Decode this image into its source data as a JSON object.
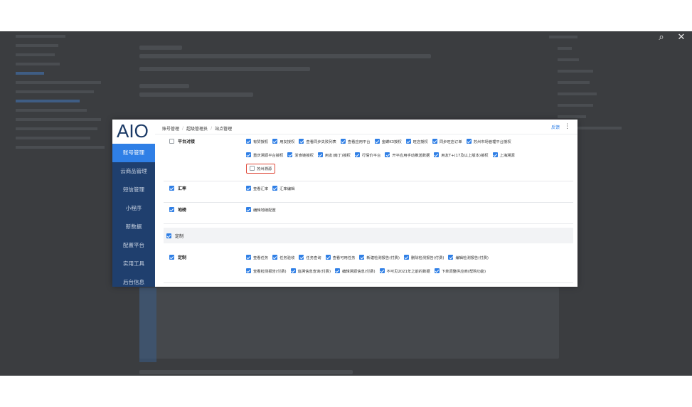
{
  "viewer": {
    "zoom_icon": "search-icon",
    "close_icon": "close-icon",
    "zoom_glyph": "⌕",
    "close_glyph": "✕"
  },
  "screenshot": {
    "brand": "AIO",
    "sidebar": [
      {
        "label": "账号管理",
        "active": true
      },
      {
        "label": "云商品管理",
        "active": false
      },
      {
        "label": "短信管理",
        "active": false
      },
      {
        "label": "小程序",
        "active": false
      },
      {
        "label": "新数据",
        "active": false
      },
      {
        "label": "配置平台",
        "active": false
      },
      {
        "label": "实用工具",
        "active": false
      },
      {
        "label": "后台信息",
        "active": false
      }
    ],
    "breadcrumb": [
      "账号管理",
      "超级管理员",
      "站点管理"
    ],
    "feedback": "反馈",
    "more_glyph": "⋮",
    "rows": [
      {
        "label": "平台对接",
        "checked": false,
        "lines": [
          [
            {
              "text": "有赞授权",
              "checked": true
            },
            {
              "text": "用友授权",
              "checked": true
            },
            {
              "text": "查看同步失败列表",
              "checked": true
            },
            {
              "text": "查看应用平台",
              "checked": true
            },
            {
              "text": "金蝶K3授权",
              "checked": true
            },
            {
              "text": "旺店授权",
              "checked": true
            },
            {
              "text": "同步旺店订单",
              "checked": true
            },
            {
              "text": "苏州市场管理平台授权",
              "checked": true
            }
          ],
          [
            {
              "text": "重庆溯源平台授权",
              "checked": true
            },
            {
              "text": "浙食链授权",
              "checked": true
            },
            {
              "text": "用友(南丁)授权",
              "checked": true
            },
            {
              "text": "行情价平台",
              "checked": true
            },
            {
              "text": "开平应用手动推送数据",
              "checked": true
            },
            {
              "text": "用友T+(17及以上版本)授权",
              "checked": true
            },
            {
              "text": "上海溯源",
              "checked": true
            }
          ],
          [
            {
              "text": "苏州溯源",
              "checked": false,
              "highlight": true
            }
          ]
        ]
      },
      {
        "label": "汇率",
        "checked": true,
        "lines": [
          [
            {
              "text": "查看汇率",
              "checked": true
            },
            {
              "text": "汇率编辑",
              "checked": true
            }
          ]
        ]
      },
      {
        "label": "地磅",
        "checked": true,
        "lines": [
          [
            {
              "text": "编辑地磅配置",
              "checked": true
            }
          ]
        ]
      }
    ],
    "section": {
      "label": "定制",
      "checked": true
    },
    "custom_row": {
      "label": "定制",
      "checked": true,
      "lines": [
        [
          {
            "text": "查看任务",
            "checked": true
          },
          {
            "text": "任务验收",
            "checked": true
          },
          {
            "text": "任务查询",
            "checked": true
          },
          {
            "text": "查看可用任务",
            "checked": true
          },
          {
            "text": "新建检测报告(付费)",
            "checked": true
          },
          {
            "text": "删除检测报告(付费)",
            "checked": true
          },
          {
            "text": "编辑检测报告(付费)",
            "checked": true
          }
        ],
        [
          {
            "text": "查看检测报告(付费)",
            "checked": true
          },
          {
            "text": "追溯信息查询(付费)",
            "checked": true
          },
          {
            "text": "编辑溯源信息(付费)",
            "checked": true
          },
          {
            "text": "不可见2021年之前的数据",
            "checked": true
          },
          {
            "text": "下单调整供应商(帮购功能)",
            "checked": true
          }
        ]
      ]
    }
  },
  "colors": {
    "backdrop": "#3b3d40",
    "sidebar": "#1f3f6e",
    "sidebar_active": "#2f7fe6",
    "checkbox": "#2f7fe6",
    "highlight": "#e04a3a"
  }
}
